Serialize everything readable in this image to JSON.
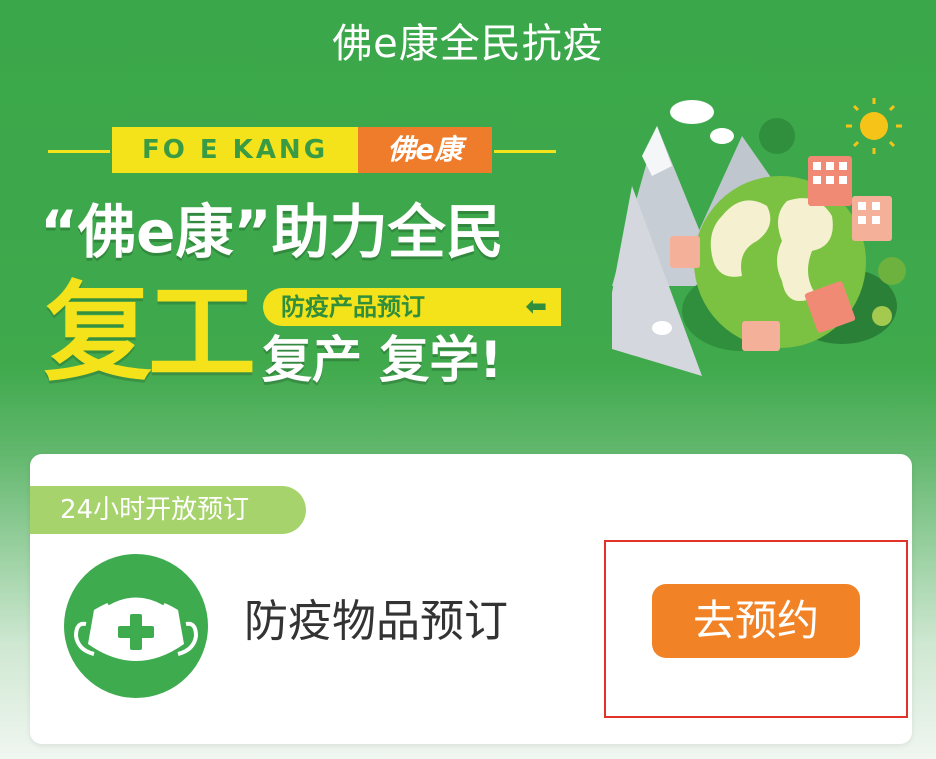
{
  "header": {
    "title": "佛e康全民抗疫"
  },
  "banner": {
    "brand_en": "FO E KANG",
    "brand_cn": "佛e康",
    "headline": "“佛e康”助力全民",
    "big_word": "复工",
    "promo_tag": "防疫产品预订",
    "promo_arrow": "⬅",
    "sub_headline": "复产 复学!",
    "colors": {
      "yellow": "#f4e21a",
      "orange": "#ee7c2a",
      "green": "#3aa74a"
    }
  },
  "card": {
    "tag": "24小时开放预订",
    "icon": "mask-plus-icon",
    "title": "防疫物品预订",
    "button_label": "去预约",
    "colors": {
      "button": "#f18326",
      "highlight": "#e2332b",
      "tag": "#a7d36d"
    }
  }
}
